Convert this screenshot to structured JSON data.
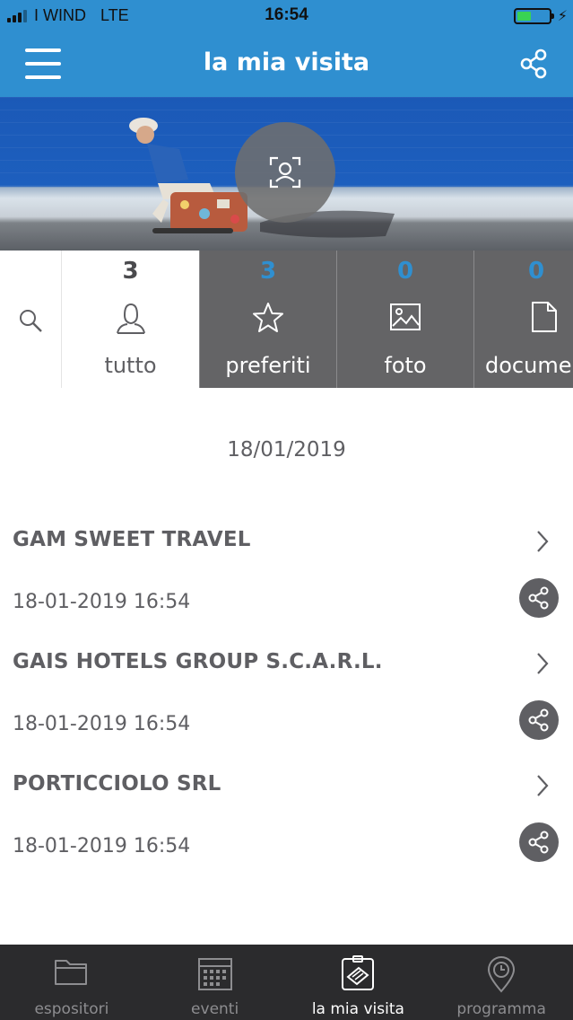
{
  "status_bar": {
    "carrier": "I WIND",
    "network": "LTE",
    "time": "16:54"
  },
  "header": {
    "title": "la mia visita",
    "menu_icon": "hamburger-menu-icon",
    "share_icon": "share-icon"
  },
  "hero": {
    "profile_icon": "profile-scan-icon"
  },
  "tabs": [
    {
      "count": "3",
      "label": "tutto",
      "icon": "person-icon",
      "active": true
    },
    {
      "count": "3",
      "label": "preferiti",
      "icon": "star-icon",
      "active": false
    },
    {
      "count": "0",
      "label": "foto",
      "icon": "image-icon",
      "active": false
    },
    {
      "count": "0",
      "label": "docume",
      "icon": "document-icon",
      "active": false
    }
  ],
  "content": {
    "date_heading": "18/01/2019",
    "entries": [
      {
        "name": "GAM SWEET TRAVEL",
        "timestamp": "18-01-2019 16:54"
      },
      {
        "name": "GAIS HOTELS GROUP S.C.A.R.L.",
        "timestamp": "18-01-2019 16:54"
      },
      {
        "name": "PORTICCIOLO SRL",
        "timestamp": "18-01-2019 16:54"
      }
    ]
  },
  "bottom_nav": [
    {
      "label": "espositori",
      "icon": "folder-icon",
      "active": false
    },
    {
      "label": "eventi",
      "icon": "calendar-icon",
      "active": false
    },
    {
      "label": "la mia visita",
      "icon": "badge-icon",
      "active": true
    },
    {
      "label": "programma",
      "icon": "location-clock-icon",
      "active": false
    }
  ],
  "colors": {
    "brand_blue": "#2f8fd0",
    "tab_gray": "#646466",
    "nav_dark": "#2b2b2d",
    "text_gray": "#5f5f63"
  }
}
